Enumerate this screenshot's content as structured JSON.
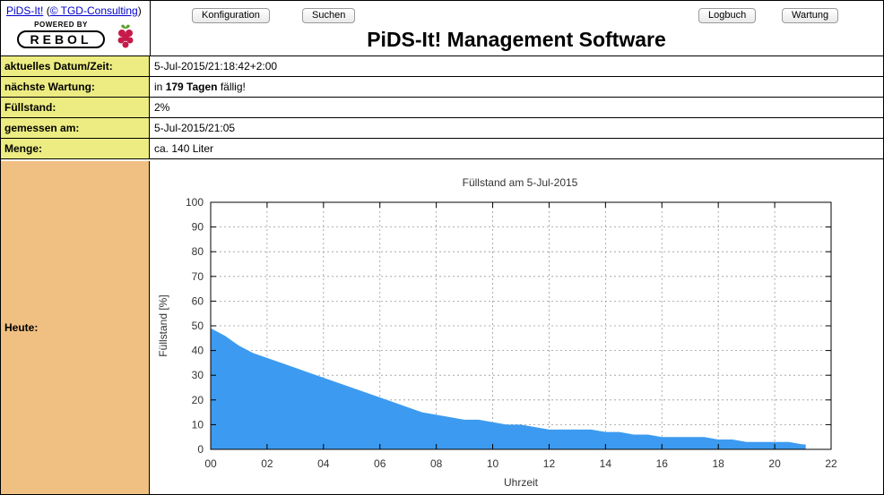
{
  "header": {
    "app_link": "PiDS-It!",
    "copyright_prefix": "(",
    "copyright_link": "© TGD-Consulting",
    "copyright_suffix": ")",
    "powered_by": "POWERED BY",
    "rebol_word": "REBOL",
    "buttons": {
      "konfiguration": "Konfiguration",
      "suchen": "Suchen",
      "logbuch": "Logbuch",
      "wartung": "Wartung"
    },
    "title": "PiDS-It! Management Software"
  },
  "rows": {
    "datum": {
      "label": "aktuelles Datum/Zeit:",
      "value": "5-Jul-2015/21:18:42+2:00"
    },
    "wartung": {
      "label": "nächste Wartung:",
      "prefix": "in ",
      "days": "179 Tagen",
      "suffix": " fällig!"
    },
    "fuellstand": {
      "label": "Füllstand:",
      "value": "2%"
    },
    "gemessen": {
      "label": "gemessen am:",
      "value": "5-Jul-2015/21:05"
    },
    "menge": {
      "label": "Menge:",
      "value": "ca. 140 Liter"
    },
    "heute": {
      "label": "Heute:"
    }
  },
  "colors": {
    "label_yellow": "#ecec82",
    "label_orange": "#f0c082",
    "area_fill": "#3c9bf0",
    "link_blue": "#0000cc"
  },
  "icons": [
    "raspberry-pi-icon",
    "rebol-logo"
  ],
  "chart_data": {
    "type": "area",
    "title": "Füllstand am 5-Jul-2015",
    "xlabel": "Uhrzeit",
    "ylabel": "Füllstand [%]",
    "xlim": [
      0,
      22
    ],
    "ylim": [
      0,
      100
    ],
    "x_ticks": [
      "00",
      "02",
      "04",
      "06",
      "08",
      "10",
      "12",
      "14",
      "16",
      "18",
      "20",
      "22"
    ],
    "y_ticks": [
      "0",
      "10",
      "20",
      "30",
      "40",
      "50",
      "60",
      "70",
      "80",
      "90",
      "100"
    ],
    "grid": true,
    "series": [
      {
        "x": [
          0,
          0.5,
          1,
          1.5,
          2,
          2.5,
          3,
          3.5,
          4,
          4.5,
          5,
          5.5,
          6,
          6.5,
          7,
          7.5,
          8,
          8.5,
          9,
          9.5,
          10,
          10.5,
          11,
          11.5,
          12,
          12.5,
          13,
          13.5,
          14,
          14.5,
          15,
          15.5,
          16,
          16.5,
          17,
          17.5,
          18,
          18.5,
          19,
          19.5,
          20,
          20.5,
          21,
          21.1
        ],
        "y": [
          49,
          46,
          42,
          39,
          37,
          35,
          33,
          31,
          29,
          27,
          25,
          23,
          21,
          19,
          17,
          15,
          14,
          13,
          12,
          12,
          11,
          10,
          10,
          9,
          8,
          8,
          8,
          8,
          7,
          7,
          6,
          6,
          5,
          5,
          5,
          5,
          4,
          4,
          3,
          3,
          3,
          3,
          2,
          2
        ]
      }
    ]
  }
}
